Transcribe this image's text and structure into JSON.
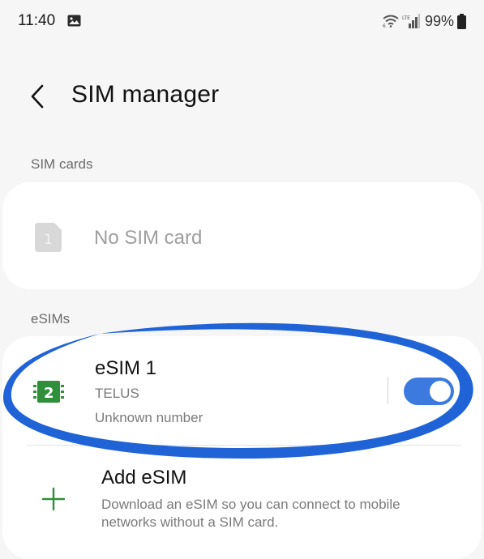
{
  "status_bar": {
    "time": "11:40",
    "battery": "99%"
  },
  "header": {
    "title": "SIM manager"
  },
  "sim_cards": {
    "section_label": "SIM cards",
    "empty_text": "No SIM card",
    "slot_number": "1"
  },
  "esims": {
    "section_label": "eSIMs",
    "items": [
      {
        "name": "eSIM 1",
        "carrier": "TELUS",
        "number": "Unknown number",
        "slot_number": "2",
        "enabled": true
      }
    ],
    "add": {
      "title": "Add eSIM",
      "description": "Download an eSIM so you can connect to mobile networks without a SIM card."
    }
  },
  "colors": {
    "accent": "#3d7ae0",
    "esim_icon": "#2f8f3a",
    "highlight_circle": "#1f63d6",
    "background": "#f6f6f6"
  },
  "icons": {
    "back": "back-arrow-icon",
    "gallery": "gallery-icon",
    "wifi": "wifi-icon",
    "signal": "signal-icon",
    "battery": "battery-icon",
    "sim": "sim-card-icon",
    "esim": "esim-icon",
    "add": "plus-icon"
  }
}
